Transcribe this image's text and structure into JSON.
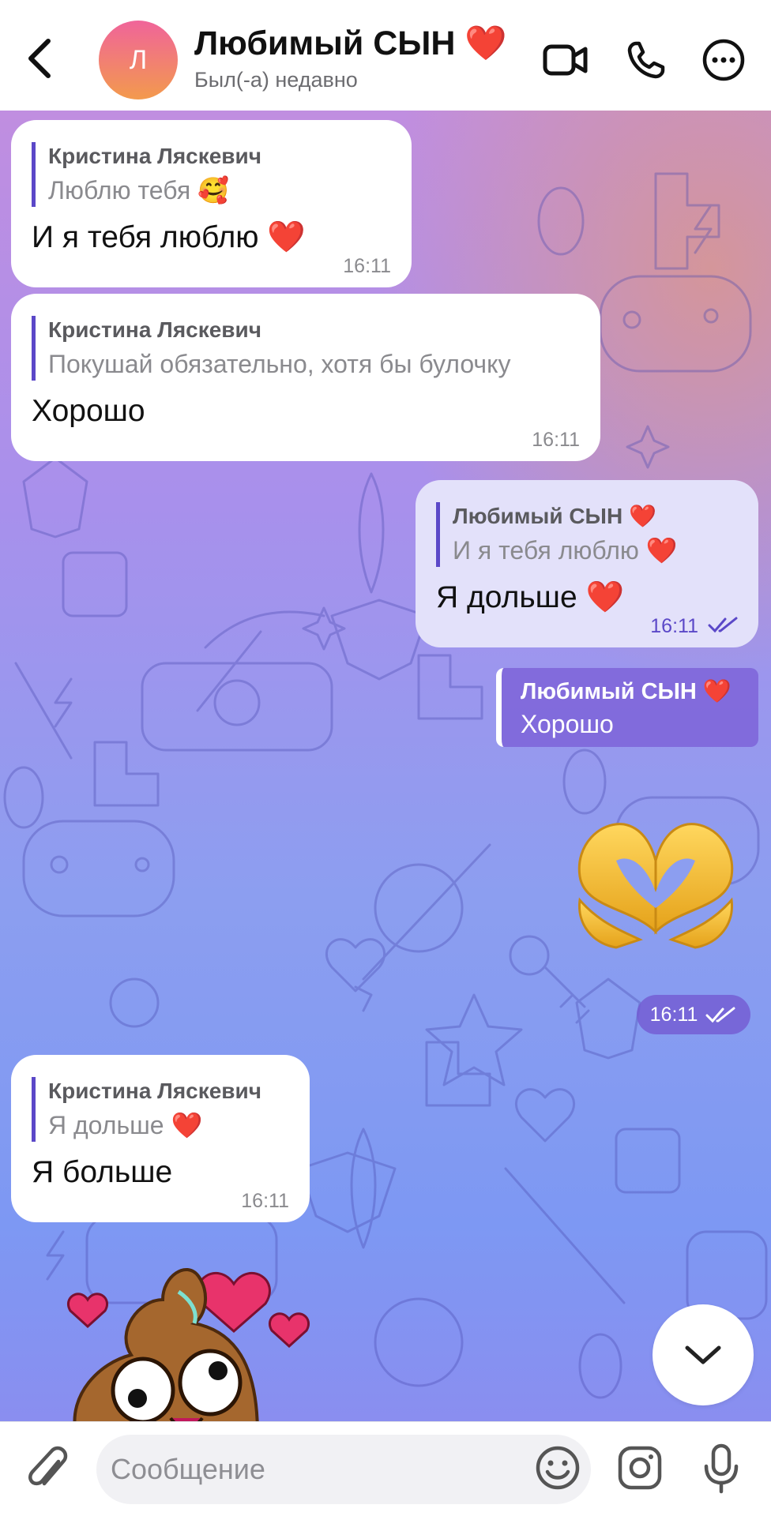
{
  "header": {
    "avatar_letter": "Л",
    "title": "Любимый СЫН ❤️",
    "subtitle": "Был(-а) недавно",
    "icons": [
      "back-icon",
      "video-call-icon",
      "phone-icon",
      "more-icon"
    ]
  },
  "messages": [
    {
      "direction": "in",
      "quote_name": "Кристина Ляскевич",
      "quote_text": "Люблю тебя 🥰",
      "text": "И я тебя люблю ❤️",
      "time": "16:11"
    },
    {
      "direction": "in",
      "quote_name": "Кристина Ляскевич",
      "quote_text": "Покушай обязательно, хотя бы булочку",
      "text": "Хорошо",
      "time": "16:11"
    },
    {
      "direction": "out",
      "quote_name": "Любимый СЫН ❤️",
      "quote_text": "И я тебя люблю ❤️",
      "text": "Я дольше ❤️",
      "time": "16:11",
      "status": "read"
    },
    {
      "direction": "in",
      "quote_name": "Кристина Ляскевич",
      "quote_text": "Я дольше ❤️",
      "text": "Я больше",
      "time": "16:11"
    }
  ],
  "reply_chip": {
    "name": "Любимый СЫН ❤️",
    "text": "Хорошо"
  },
  "heart_hands": {
    "emoji": "🫶",
    "time": "16:11",
    "status": "read"
  },
  "composer": {
    "placeholder": "Сообщение",
    "value": ""
  },
  "colors": {
    "accent": "#5b48c8",
    "incoming_bubble": "#ffffff",
    "outgoing_bubble": "#e3e1fa"
  }
}
